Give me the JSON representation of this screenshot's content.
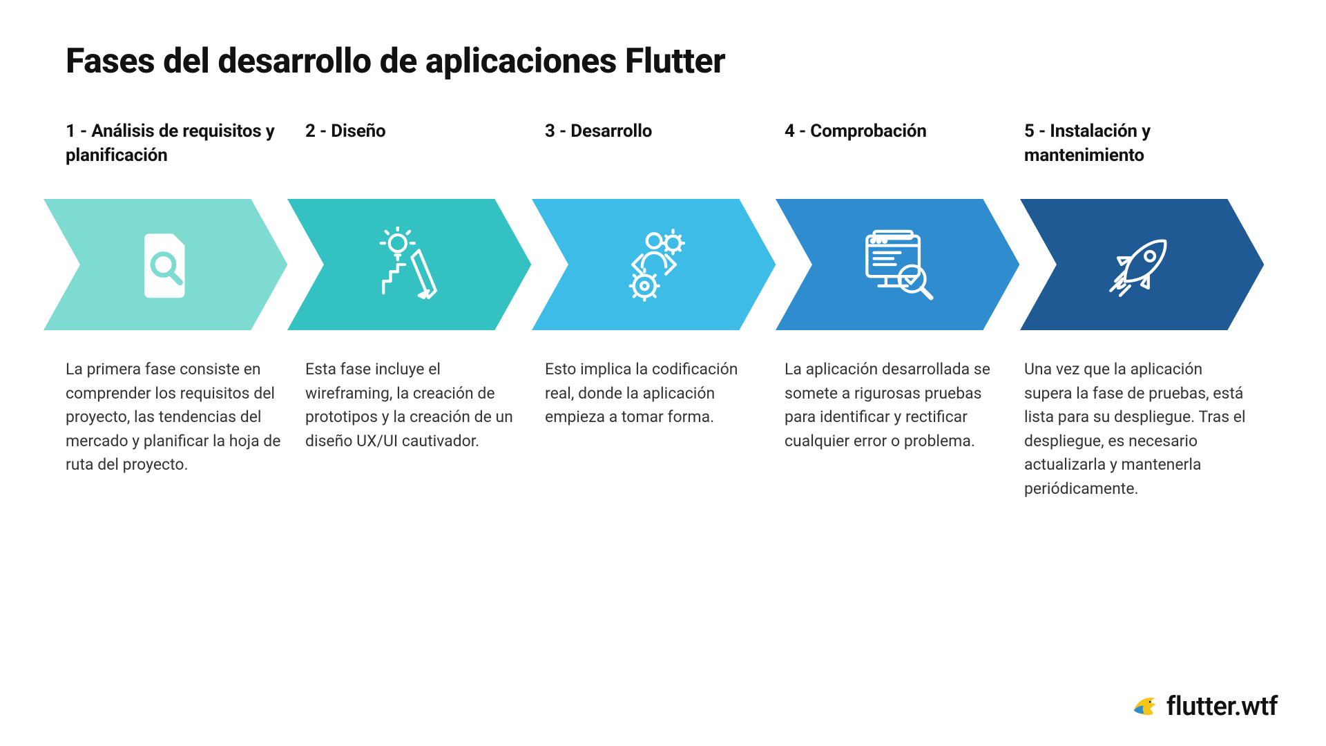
{
  "title": "Fases del desarrollo de aplicaciones Flutter",
  "phases": [
    {
      "label": "1 - Análisis de requisitos y planificación",
      "desc": "La primera fase consiste en comprender los requisitos del proyecto, las tendencias del mercado y planificar la hoja de ruta del proyecto.",
      "color": "#7edbd2",
      "icon": "document-search-icon"
    },
    {
      "label": "2 - Diseño",
      "desc": "Esta fase incluye el wireframing, la creación de prototipos y la creación de un diseño UX/UI cautivador.",
      "color": "#33c1c1",
      "icon": "design-idea-icon"
    },
    {
      "label": "3 - Desarrollo",
      "desc": "Esto implica la codificación real, donde la aplicación empieza a tomar forma.",
      "color": "#3dbce8",
      "icon": "developer-gear-icon"
    },
    {
      "label": "4 - Comprobación",
      "desc": "La aplicación desarrollada se somete a rigurosas pruebas para identificar y rectificar cualquier error o problema.",
      "color": "#2f8dcf",
      "icon": "testing-check-icon"
    },
    {
      "label": "5 - Instalación y mantenimiento",
      "desc": "Una vez que la aplicación supera la fase de pruebas, está lista para su despliegue. Tras el despliegue, es necesario actualizarla y mantenerla periódicamente.",
      "color": "#1f5a94",
      "icon": "rocket-launch-icon"
    }
  ],
  "footer": {
    "brand": "flutter.wtf"
  }
}
